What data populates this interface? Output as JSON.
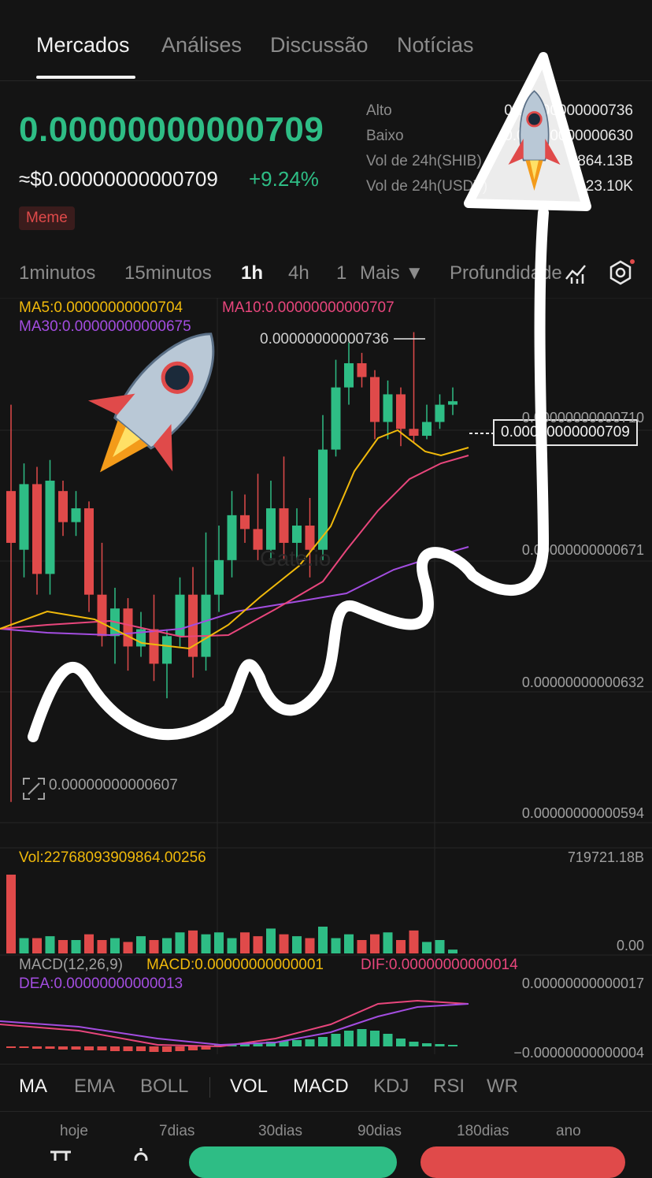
{
  "tabs": [
    {
      "label": "Mercados",
      "active": true
    },
    {
      "label": "Análises"
    },
    {
      "label": "Discussão"
    },
    {
      "label": "Notícias"
    }
  ],
  "ticker": {
    "price": "0.00000000000709",
    "usd_price": "≈$0.00000000000709",
    "change": "+9.24%",
    "tag": "Meme"
  },
  "stats": [
    {
      "label": "Alto",
      "value": "0.00000000000736"
    },
    {
      "label": "Baixo",
      "value": "0.00000000000630"
    },
    {
      "label": "Vol de 24h(SHIB)",
      "value": "864.13B"
    },
    {
      "label": "Vol de 24h(USDT)",
      "value": "23.10K"
    }
  ],
  "timeframes": [
    "1minutos",
    "15minutos",
    "1h",
    "4h",
    "1",
    "Mais ▼",
    "Profundidade"
  ],
  "active_timeframe": "1h",
  "chart_labels": {
    "ma5": "MA5:0.00000000000704",
    "ma10": "MA10:0.00000000000707",
    "ma30": "MA30:0.00000000000675",
    "high_marker": "0.00000000000736",
    "current_price": "0.00000000000709",
    "low_marker": "0.00000000000607",
    "axis": [
      "0.00000000000710",
      "0.00000000000671",
      "0.00000000000632",
      "0.00000000000594"
    ],
    "vol": "Vol:22768093909864.00256",
    "vol_max": "719721.18B",
    "vol_min": "0.00",
    "macd_title": "MACD(12,26,9)",
    "macd_val": "MACD:0.00000000000001",
    "dif": "DIF:0.00000000000014",
    "dea": "DEA:0.00000000000013",
    "macd_max": "0.00000000000017",
    "macd_min": "−0.00000000000004",
    "watermark": "Gate.io"
  },
  "chart_data": {
    "type": "candlestick",
    "candles": [
      [
        690,
        675,
        715,
        600
      ],
      [
        673,
        692,
        698,
        665
      ],
      [
        692,
        666,
        697,
        660
      ],
      [
        666,
        693,
        699,
        660
      ],
      [
        690,
        681,
        693,
        677
      ],
      [
        681,
        685,
        690,
        677
      ],
      [
        685,
        660,
        687,
        655
      ],
      [
        660,
        648,
        675,
        645
      ],
      [
        648,
        656,
        662,
        640
      ],
      [
        656,
        645,
        659,
        638
      ],
      [
        645,
        650,
        655,
        642
      ],
      [
        650,
        640,
        660,
        635
      ],
      [
        640,
        648,
        650,
        630
      ],
      [
        648,
        660,
        665,
        645
      ],
      [
        660,
        642,
        668,
        636
      ],
      [
        642,
        660,
        678,
        638
      ],
      [
        660,
        670,
        680,
        655
      ],
      [
        670,
        683,
        690,
        665
      ],
      [
        683,
        679,
        689,
        675
      ],
      [
        679,
        673,
        695,
        670
      ],
      [
        673,
        685,
        693,
        670
      ],
      [
        685,
        675,
        700,
        670
      ],
      [
        675,
        680,
        685,
        670
      ],
      [
        680,
        673,
        688,
        665
      ],
      [
        673,
        702,
        712,
        670
      ],
      [
        702,
        720,
        728,
        700
      ],
      [
        720,
        727,
        733,
        715
      ],
      [
        727,
        723,
        730,
        720
      ],
      [
        723,
        710,
        725,
        705
      ],
      [
        710,
        718,
        722,
        705
      ],
      [
        718,
        708,
        720,
        703
      ],
      [
        708,
        706,
        736,
        704
      ],
      [
        706,
        710,
        715,
        705
      ],
      [
        710,
        715,
        718,
        708
      ],
      [
        715,
        716,
        720,
        712
      ]
    ],
    "volumes": [
      719721,
      80,
      80,
      90,
      70,
      70,
      100,
      70,
      80,
      60,
      90,
      70,
      80,
      110,
      120,
      100,
      110,
      80,
      110,
      90,
      130,
      100,
      90,
      80,
      140,
      80,
      100,
      70,
      100,
      110,
      70,
      120,
      60,
      70,
      20
    ],
    "ylim": [
      594,
      740
    ],
    "ma_series": [
      "MA5",
      "MA10",
      "MA30"
    ],
    "indicators": [
      "MA",
      "EMA",
      "BOLL",
      "VOL",
      "MACD",
      "KDJ",
      "RSI",
      "WR"
    ],
    "periods": [
      "hoje",
      "7dias",
      "30dias",
      "90dias",
      "180dias",
      "ano"
    ]
  },
  "colors": {
    "up": "#2ebd85",
    "down": "#e04a4a",
    "ma5": "#f0b90b",
    "ma10": "#e8467c",
    "ma30": "#a34de0",
    "bg": "#141414"
  }
}
